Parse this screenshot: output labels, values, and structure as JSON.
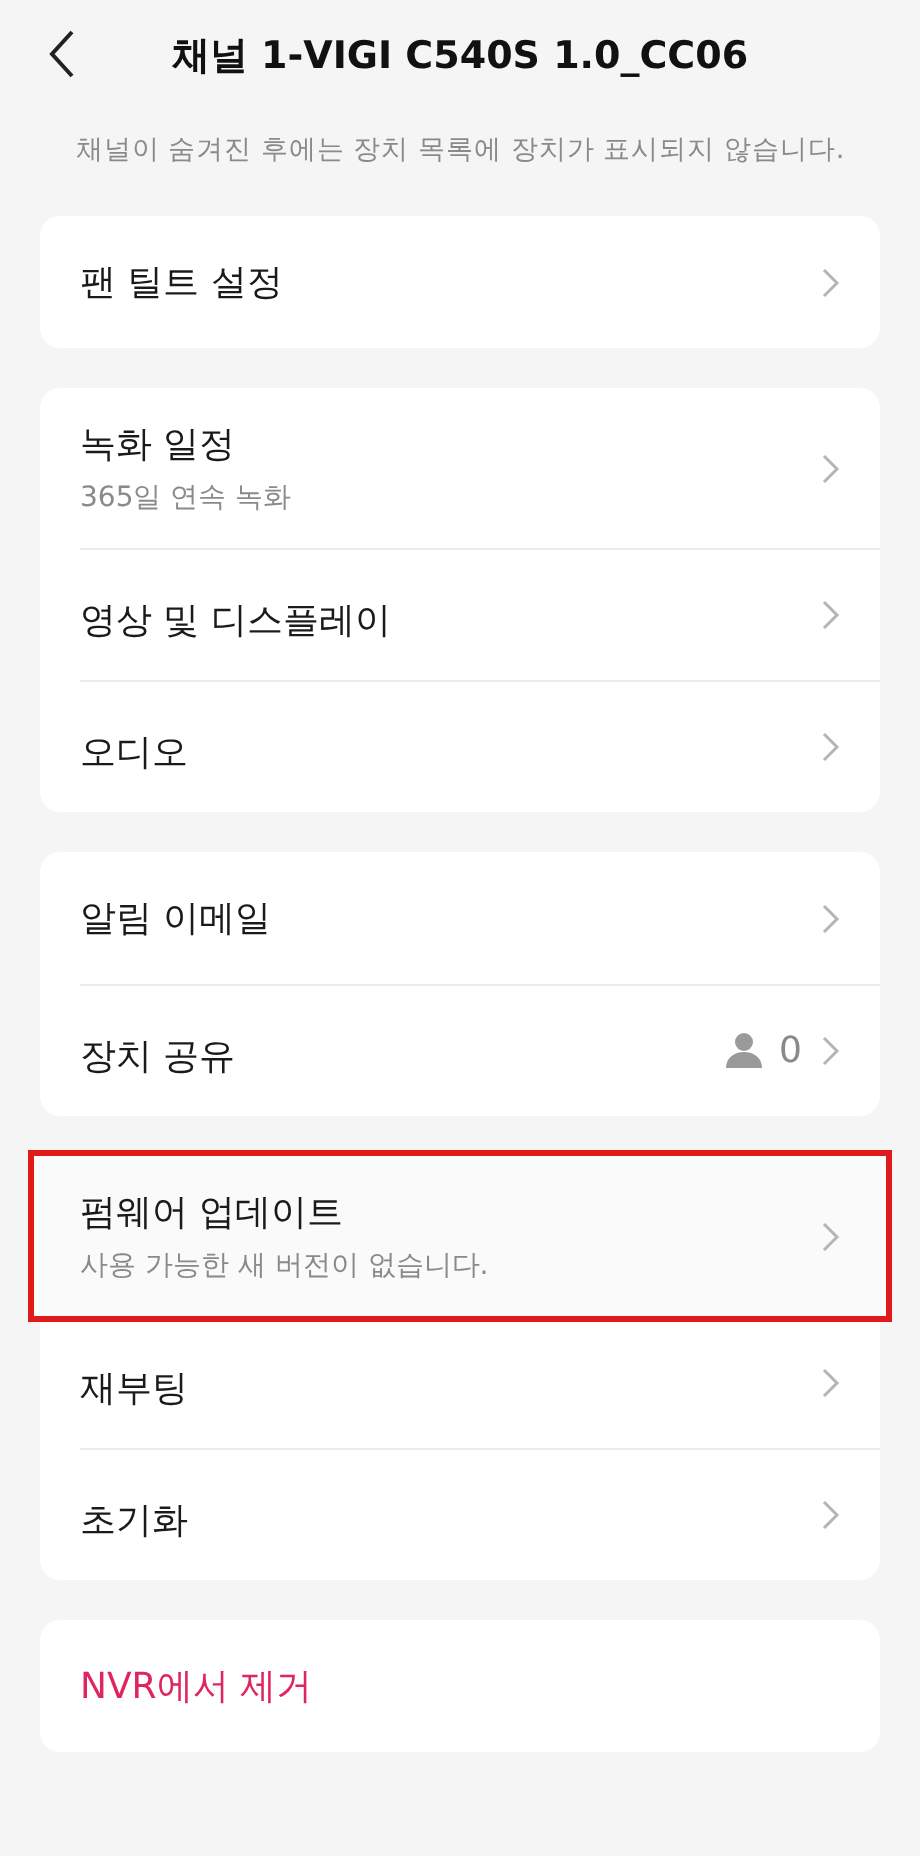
{
  "header": {
    "title": "채널 1-VIGI C540S 1.0_CC06"
  },
  "notice": "채널이 숨겨진 후에는 장치 목록에 장치가 표시되지 않습니다.",
  "groups": [
    {
      "items": [
        {
          "kind": "link",
          "label": "팬 틸트 설정",
          "highlighted": false
        }
      ]
    },
    {
      "items": [
        {
          "kind": "link",
          "label": "녹화 일정",
          "sublabel": "365일 연속 녹화",
          "highlighted": false
        },
        {
          "kind": "link",
          "label": "영상 및 디스플레이",
          "highlighted": false
        },
        {
          "kind": "link",
          "label": "오디오",
          "highlighted": false
        }
      ]
    },
    {
      "items": [
        {
          "kind": "link",
          "label": "알림 이메일",
          "highlighted": false
        },
        {
          "kind": "share",
          "label": "장치 공유",
          "value": "0",
          "highlighted": false
        }
      ]
    },
    {
      "items": [
        {
          "kind": "link",
          "label": "펌웨어 업데이트",
          "sublabel": "사용 가능한 새 버전이 없습니다.",
          "highlighted": true
        },
        {
          "kind": "link",
          "label": "재부팅",
          "highlighted": false
        },
        {
          "kind": "link",
          "label": "초기화",
          "highlighted": false
        }
      ]
    },
    {
      "items": [
        {
          "kind": "danger",
          "label": "NVR에서 제거",
          "highlighted": false
        }
      ]
    }
  ]
}
